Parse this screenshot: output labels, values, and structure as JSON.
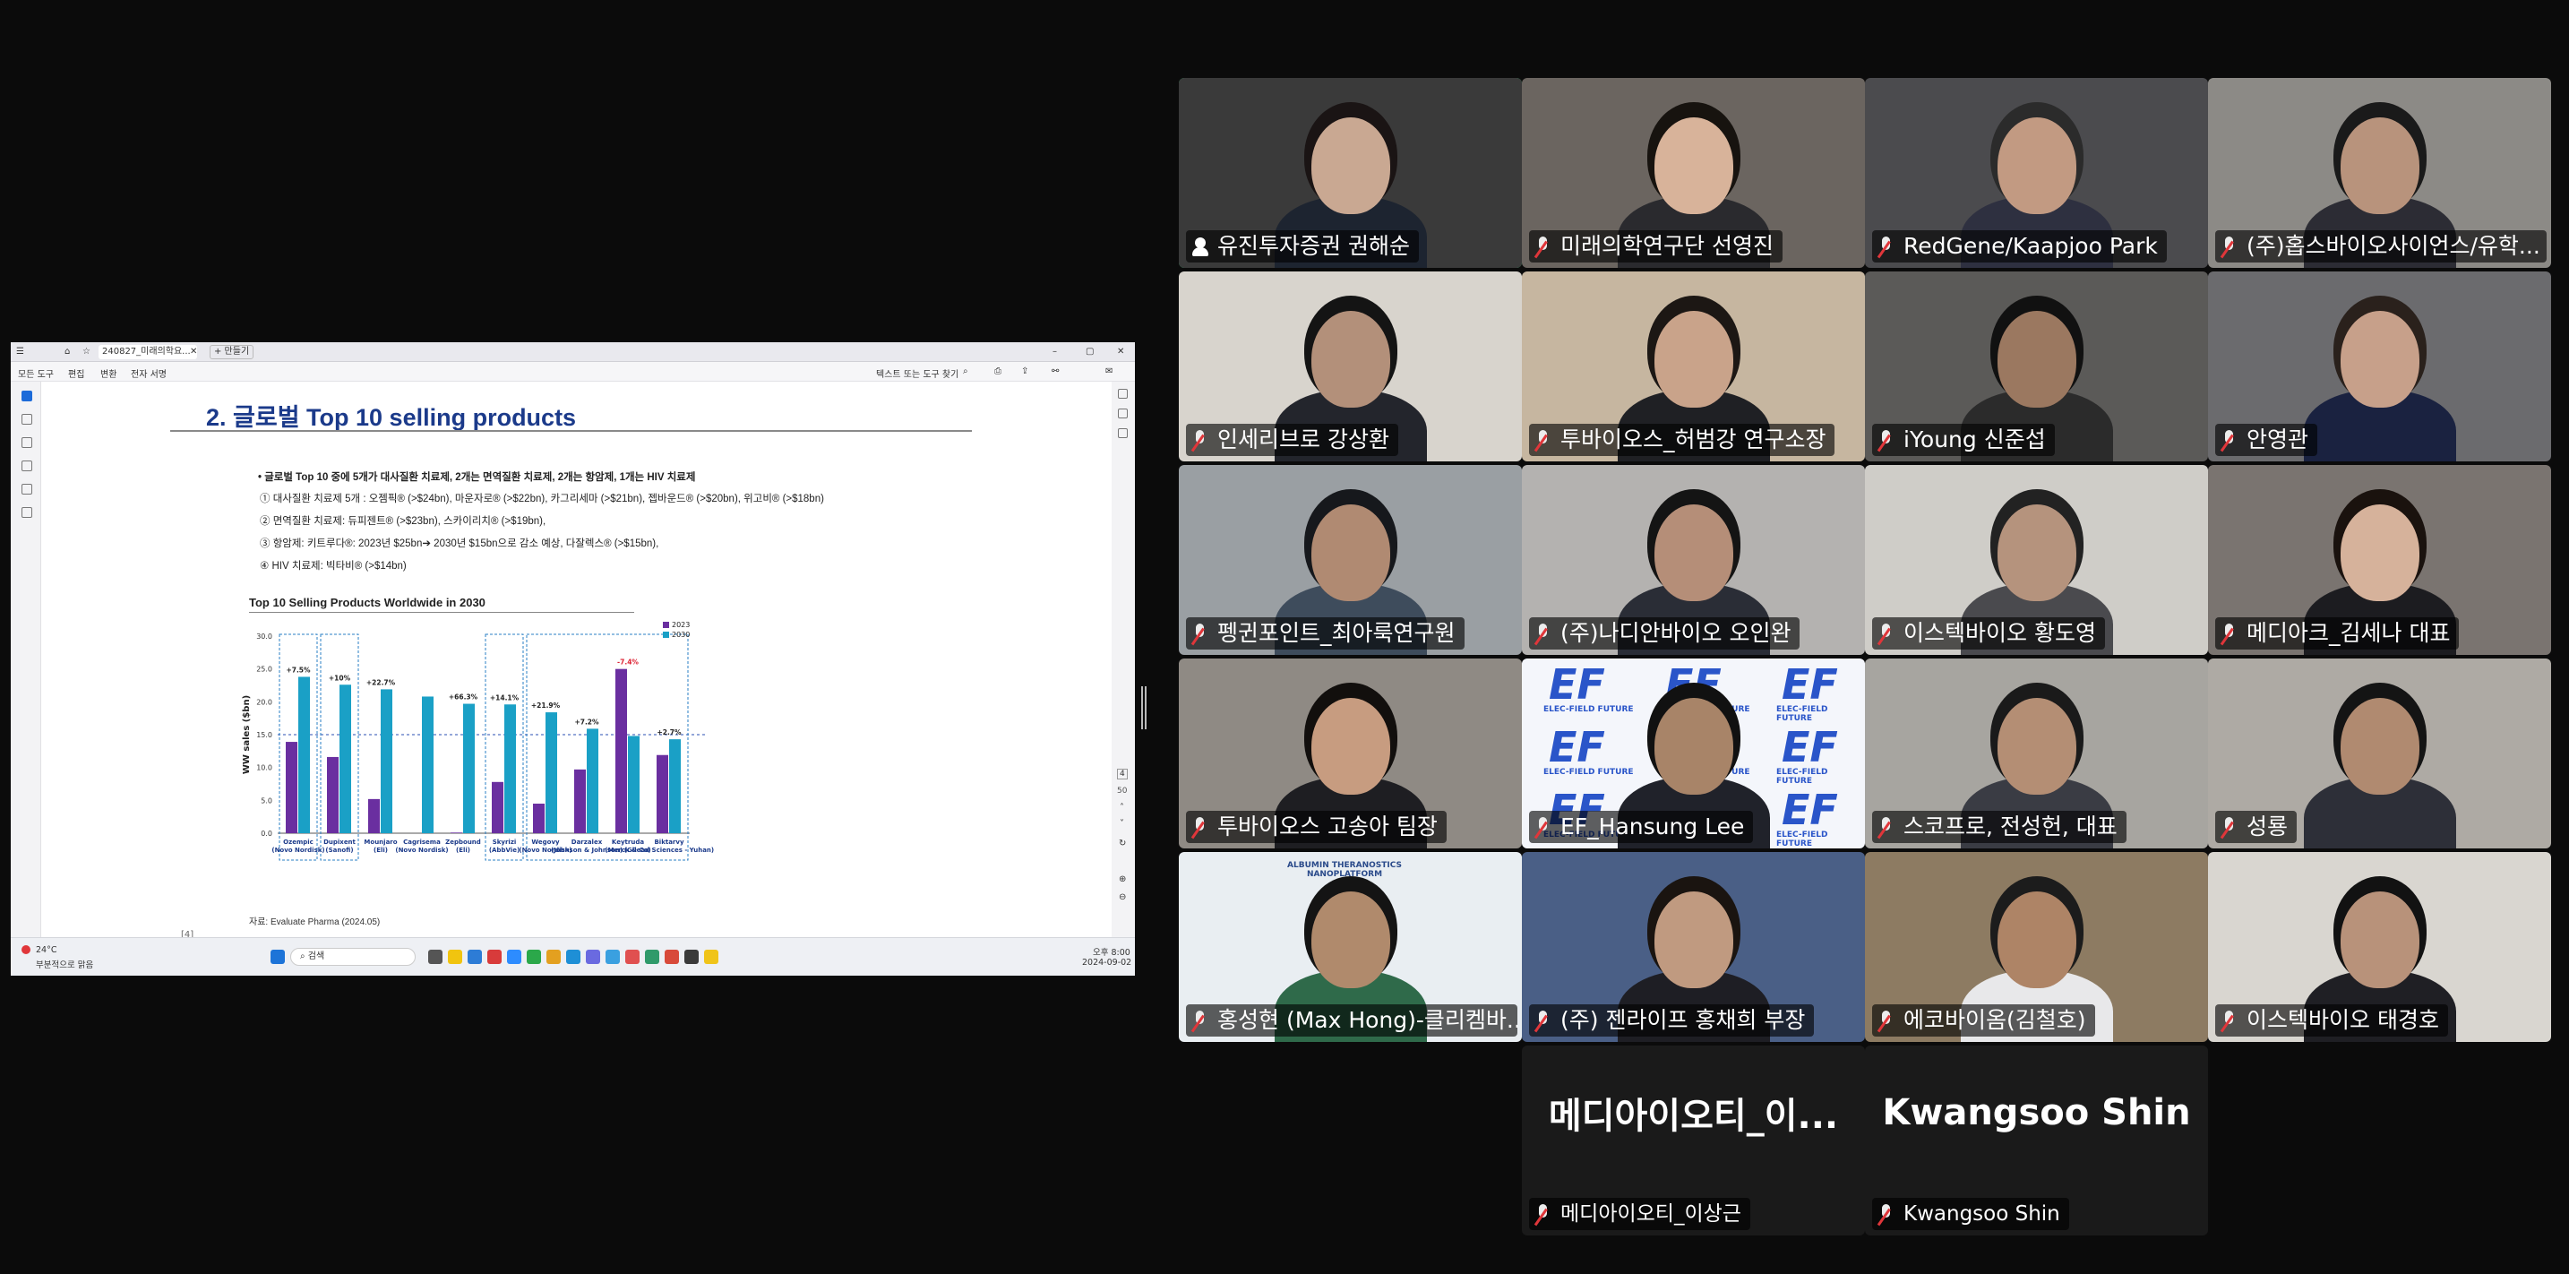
{
  "viewer": {
    "tab_home": "홈",
    "tab_doc": "240827_미래의학요...",
    "tab_new": "+ 만들기",
    "menu_tools": "모든 도구",
    "menu_edit": "편집",
    "menu_convert": "변환",
    "menu_sign": "전자 서명",
    "search_placeholder": "텍스트 또는 도구 찾기",
    "page_number": "4",
    "page_total": "50",
    "slide_footer": "[4]"
  },
  "slide": {
    "title": "2. 글로벌 Top 10 selling products",
    "bullets": [
      "•  글로벌 Top 10 중에 5개가 대사질환 치료제, 2개는 면역질환 치료제, 2개는 항암제, 1개는 HIV 치료제",
      "①   대사질환 치료제 5개 : 오젬픽® (>$24bn), 마운자로® (>$22bn), 카그리세마 (>$21bn),  젭바운드® (>$20bn), 위고비® (>$18bn)",
      "②   면역질환 치료제: 듀피젠트® (>$23bn), 스카이리치® (>$19bn),",
      "③   항암제: 키트루다®: 2023년 $25bn➔ 2030년 $15bn으로 감소 예상, 다잘렉스® (>$15bn),",
      "④   HIV 치료제: 빅타비® (>$14bn)"
    ],
    "source": "자료: Evaluate Pharma (2024.05)"
  },
  "chart_data": {
    "type": "bar",
    "title": "Top 10 Selling Products Worldwide in 2030",
    "ylabel": "WW sales ($bn)",
    "ylim": [
      0,
      30
    ],
    "yticks": [
      "0.0",
      "5.0",
      "10.0",
      "15.0",
      "20.0",
      "25.0",
      "30.0"
    ],
    "categories": [
      "Ozempic (Novo Nordisk)",
      "Dupixent (Sanofi)",
      "Mounjaro (Eli)",
      "Cagrisema (Novo Nordisk)",
      "Zepbound (Eli)",
      "Skyrizi (AbbVie)",
      "Wegovy (Novo Nordisk)",
      "Darzalex (Johnson & Johnson)",
      "Keytruda (Merck & Co)",
      "Biktarvy (Gilead Sciences - Yuhan)"
    ],
    "series": [
      {
        "name": "2023",
        "color": "#6a2fa0",
        "values": [
          13.9,
          11.6,
          5.2,
          0,
          0.1,
          7.8,
          4.5,
          9.7,
          25.0,
          11.9
        ]
      },
      {
        "name": "2030",
        "color": "#1aa0c6",
        "values": [
          23.8,
          22.6,
          21.9,
          20.8,
          19.7,
          19.6,
          18.4,
          15.9,
          14.8,
          14.3
        ]
      }
    ],
    "annotations": [
      "+7.5%",
      "+10%",
      "+22.7%",
      "",
      "+66.3%",
      "+14.1%",
      "+21.9%",
      "+7.2%",
      "-7.4%",
      "+2.7%"
    ],
    "legend_position": "top-right",
    "grid": false
  },
  "taskbar": {
    "weather_temp": "24°C",
    "weather_desc": "부분적으로 맑음",
    "search_label": "검색",
    "time": "오후 8:00",
    "date": "2024-09-02"
  },
  "participants": [
    {
      "name": "유진투자증권 권해순",
      "speaking": true,
      "bg": "#3a3a3a",
      "skin": "#c9a892",
      "shirt": "#1d2430",
      "hair": "#1a1414"
    },
    {
      "name": "미래의학연구단 선영진",
      "bg": "#6b6560",
      "skin": "#d8b39a",
      "shirt": "#2a2a2e",
      "hair": "#17130f"
    },
    {
      "name": "RedGene/Kaapjoo Park",
      "bg": "#4b4b4e",
      "skin": "#c29a82",
      "shirt": "#2e3040",
      "hair": "#2b2b2b"
    },
    {
      "name": "(주)홉스바이오사이언스/유학...",
      "bg": "#8c8a86",
      "skin": "#b8937c",
      "shirt": "#2c2c34",
      "hair": "#1a1a1a"
    },
    {
      "name": "인세리브로 강상환",
      "bg": "#d8d4cd",
      "skin": "#b3907a",
      "shirt": "#23252c",
      "hair": "#141414"
    },
    {
      "name": "투바이오스_허범강 연구소장",
      "bg": "#c6b6a0",
      "skin": "#c9a38a",
      "shirt": "#1f2024",
      "hair": "#1c1714"
    },
    {
      "name": "iYoung 신준섭",
      "bg": "#5b5a58",
      "skin": "#9b7860",
      "shirt": "#2b2b2b",
      "hair": "#111111"
    },
    {
      "name": "안영관",
      "bg": "#6b6b6e",
      "skin": "#c7a08a",
      "shirt": "#1a2240",
      "hair": "#2a211c"
    },
    {
      "name": "펭귄포인트_최아룩연구원",
      "bg": "#9a9fa3",
      "skin": "#b08a72",
      "shirt": "#3e4c5c",
      "hair": "#16181c"
    },
    {
      "name": "(주)나디안바이오 오인완",
      "bg": "#b4b2b0",
      "skin": "#b58e78",
      "shirt": "#2a2d36",
      "hair": "#141414"
    },
    {
      "name": "이스텍바이오 황도영",
      "bg": "#cfcdc8",
      "skin": "#b5937d",
      "shirt": "#4a4a4e",
      "hair": "#222222"
    },
    {
      "name": "메디아크_김세나 대표",
      "bg": "#7a7470",
      "skin": "#d6b29b",
      "shirt": "#1c1c20",
      "hair": "#1a120e"
    },
    {
      "name": "투바이오스 고송아 팀장",
      "bg": "#8f8a84",
      "skin": "#c79c80",
      "shirt": "#1e1e22",
      "hair": "#120f0d"
    },
    {
      "name": "EF_Hansung Lee",
      "bg": "#f4f6fb",
      "skin": "#a88468",
      "shirt": "#20222a",
      "hair": "#111111",
      "backdrop": "EF",
      "backdrop_text": "ELEC-FIELD FUTURE"
    },
    {
      "name": "스코프로, 전성헌, 대표",
      "bg": "#a7a5a0",
      "skin": "#b48e74",
      "shirt": "#3a3c44",
      "hair": "#1a1a1a"
    },
    {
      "name": "성룡",
      "bg": "#aeaaa4",
      "skin": "#b08a70",
      "shirt": "#2d2f38",
      "hair": "#141414"
    },
    {
      "name": "홍성현 (Max Hong)-클리켐바...",
      "bg": "#e9eef2",
      "skin": "#b08a6c",
      "shirt": "#2f6a4a",
      "hair": "#141414",
      "backdrop_text": "ALBUMIN THERANOSTICS NANOPLATFORM"
    },
    {
      "name": "(주) 젠라이프 홍채희 부장",
      "bg": "#4a5f86",
      "skin": "#c09a80",
      "shirt": "#1e1e24",
      "hair": "#1a1410"
    },
    {
      "name": "에코바이옴(김철호)",
      "bg": "#8d7b62",
      "skin": "#ae8466",
      "shirt": "#e8e8ea",
      "hair": "#1c1c1c"
    },
    {
      "name": "이스텍바이오 태경호",
      "bg": "#d9d6d0",
      "skin": "#b8927a",
      "shirt": "#1f1f24",
      "hair": "#121212"
    },
    {
      "name": "메디아이오티_이상근",
      "display": "메디아이오티_이...",
      "video_off": true
    },
    {
      "name": "Kwangsoo Shin",
      "display": "Kwangsoo Shin",
      "video_off": true
    }
  ]
}
